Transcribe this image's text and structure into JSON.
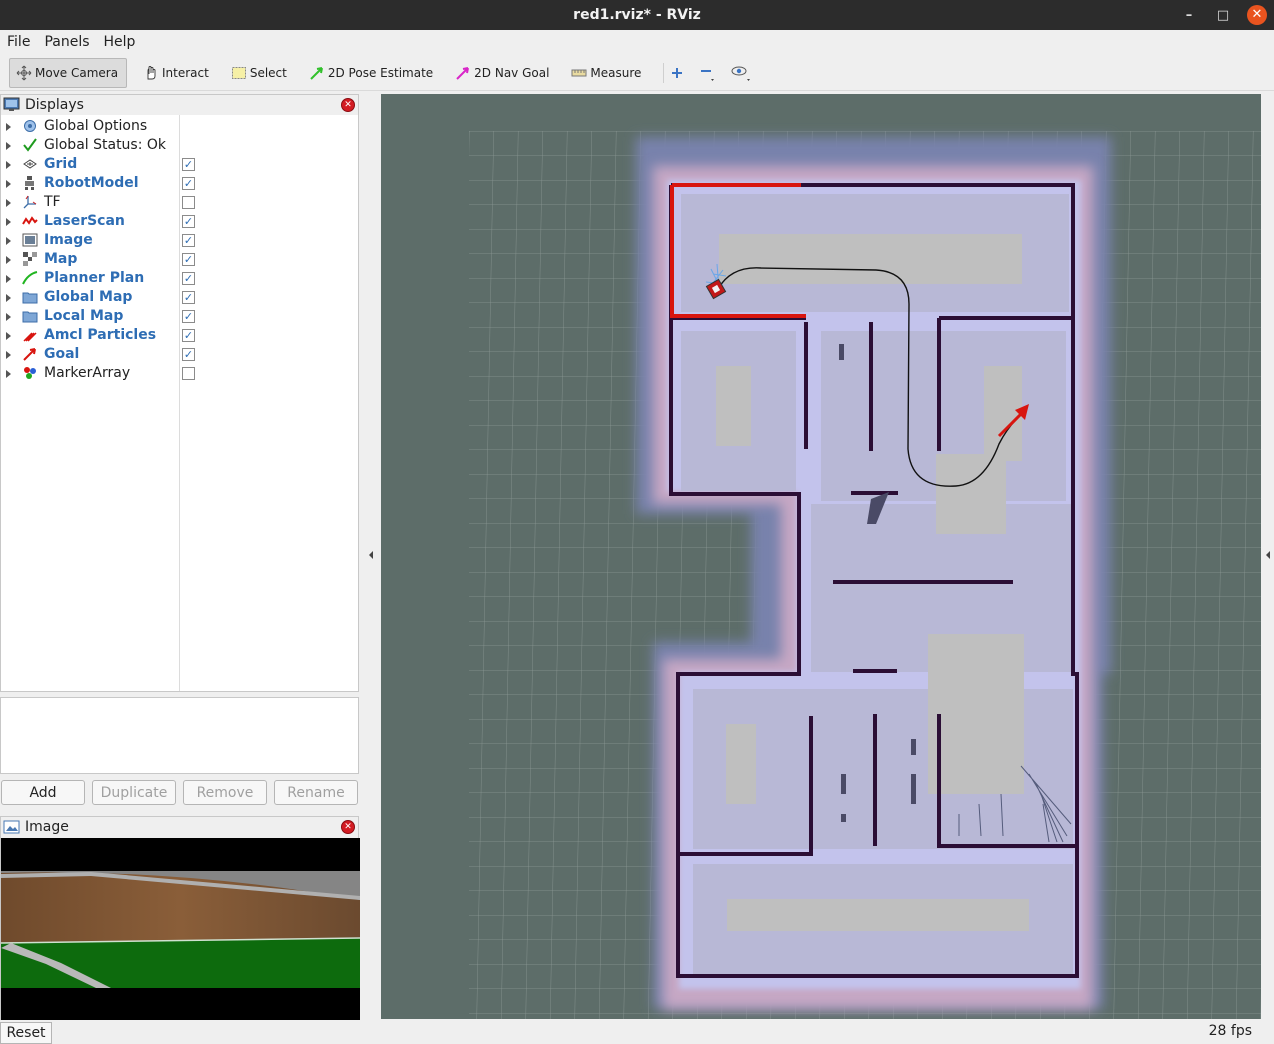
{
  "window": {
    "title": "red1.rviz* - RViz"
  },
  "menu": {
    "file": "File",
    "panels": "Panels",
    "help": "Help"
  },
  "toolbar": {
    "move_camera": "Move Camera",
    "interact": "Interact",
    "select": "Select",
    "pose_estimate": "2D Pose Estimate",
    "nav_goal": "2D Nav Goal",
    "measure": "Measure"
  },
  "displays": {
    "title": "Displays",
    "items": [
      {
        "label": "Global Options",
        "checkbox": false,
        "checked": false,
        "bold": false
      },
      {
        "label": "Global Status: Ok",
        "checkbox": false,
        "checked": false,
        "bold": false
      },
      {
        "label": "Grid",
        "checkbox": true,
        "checked": true,
        "bold": true
      },
      {
        "label": "RobotModel",
        "checkbox": true,
        "checked": true,
        "bold": true
      },
      {
        "label": "TF",
        "checkbox": true,
        "checked": false,
        "bold": false
      },
      {
        "label": "LaserScan",
        "checkbox": true,
        "checked": true,
        "bold": true
      },
      {
        "label": "Image",
        "checkbox": true,
        "checked": true,
        "bold": true
      },
      {
        "label": "Map",
        "checkbox": true,
        "checked": true,
        "bold": true
      },
      {
        "label": "Planner Plan",
        "checkbox": true,
        "checked": true,
        "bold": true
      },
      {
        "label": "Global Map",
        "checkbox": true,
        "checked": true,
        "bold": true
      },
      {
        "label": "Local Map",
        "checkbox": true,
        "checked": true,
        "bold": true
      },
      {
        "label": "Amcl Particles",
        "checkbox": true,
        "checked": true,
        "bold": true
      },
      {
        "label": "Goal",
        "checkbox": true,
        "checked": true,
        "bold": true
      },
      {
        "label": "MarkerArray",
        "checkbox": true,
        "checked": false,
        "bold": false
      }
    ],
    "check_mark": "✓"
  },
  "buttons": {
    "add": "Add",
    "duplicate": "Duplicate",
    "remove": "Remove",
    "rename": "Rename"
  },
  "image_panel": {
    "title": "Image"
  },
  "status": {
    "reset": "Reset",
    "fps": "28 fps"
  },
  "colors": {
    "accent_blue": "#2e6db4",
    "laser_red": "#d8150f",
    "map_bg": "#5d6d69"
  }
}
